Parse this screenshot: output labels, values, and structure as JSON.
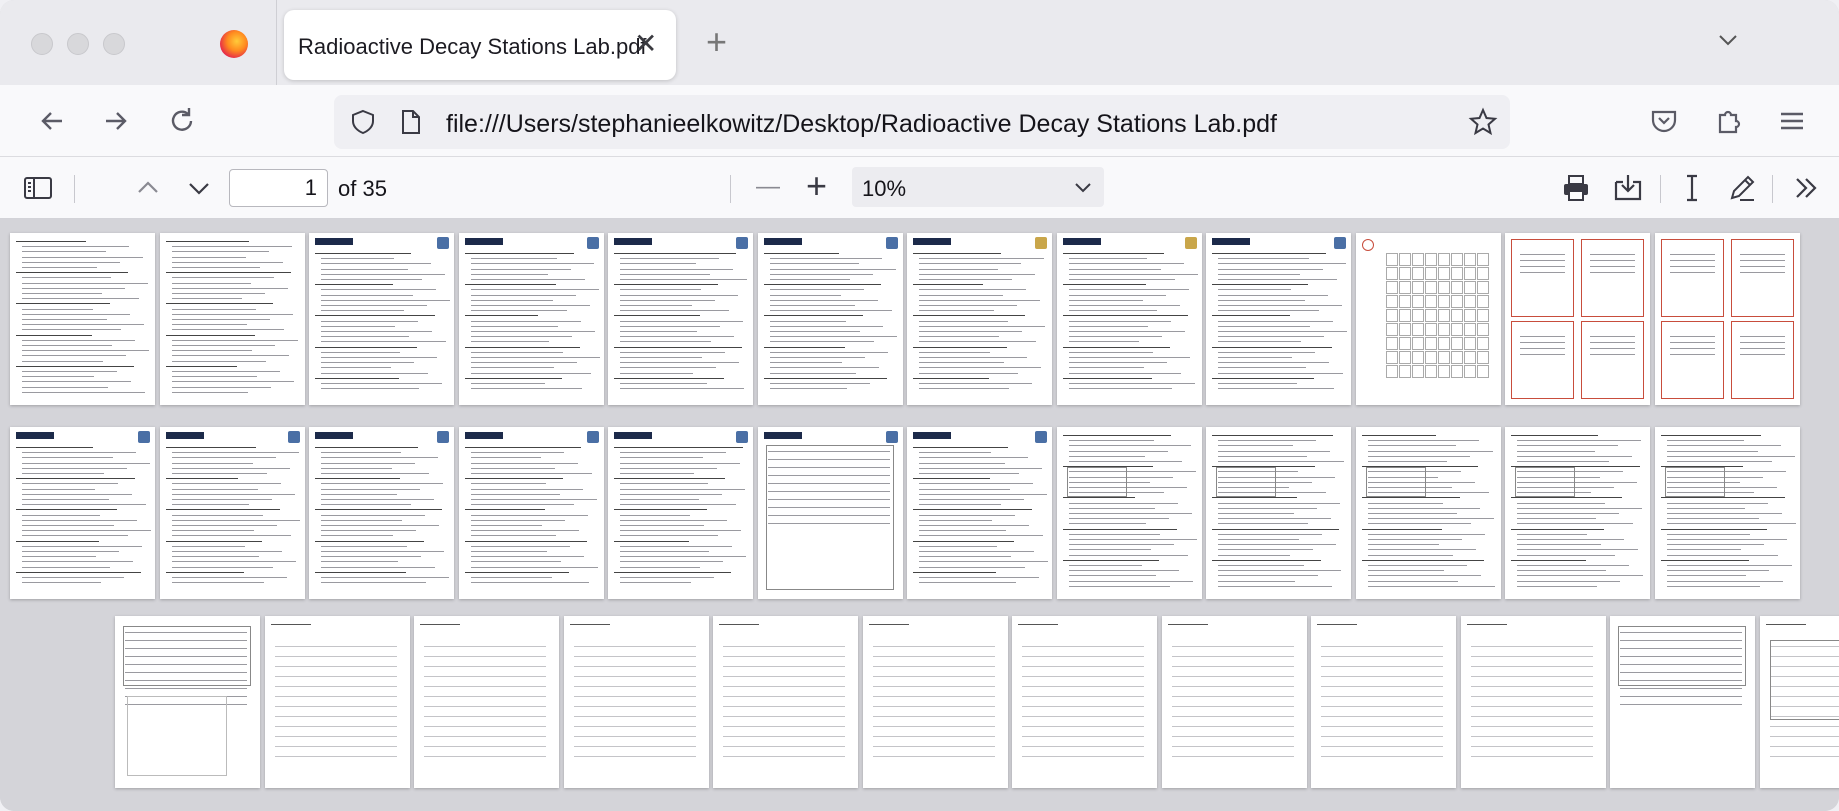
{
  "tab": {
    "title": "Radioactive Decay Stations Lab.pdf",
    "close_symbol": "✕",
    "new_tab_symbol": "+"
  },
  "navbar": {
    "url": "file:///Users/stephanieelkowitz/Desktop/Radioactive Decay Stations Lab.pdf"
  },
  "pdf_toolbar": {
    "current_page": "1",
    "page_count_label": "of 35",
    "zoom": "10%",
    "zoom_out_symbol": "—",
    "zoom_in_symbol": "+"
  },
  "icons": [
    "sidebar-toggle-icon",
    "page-up-icon",
    "page-down-icon",
    "print-icon",
    "save-icon",
    "text-select-icon",
    "draw-icon",
    "more-tools-icon",
    "back-icon",
    "forward-icon",
    "reload-icon",
    "shield-icon",
    "page-icon",
    "bookmark-star-icon",
    "pocket-icon",
    "extensions-icon",
    "menu-icon"
  ],
  "colors": {
    "accent_red": "#c84d3c",
    "header_navy": "#1c2a4a",
    "viewer_bg": "#d4d4d9"
  },
  "thumbnails": {
    "row1": [
      "cover",
      "cover2",
      "skills",
      "skills",
      "skills",
      "skills",
      "narrative",
      "narrative",
      "assessment",
      "periodic",
      "question-cards",
      "question-cards2"
    ],
    "row2": [
      "problem",
      "problem",
      "problem",
      "problem",
      "synthesis",
      "synthesis-table",
      "synthesis",
      "recording",
      "recording",
      "recording",
      "recording",
      "recording"
    ],
    "row3": [
      "recording-chart",
      "lined",
      "lined",
      "lined",
      "lined",
      "lined",
      "lined",
      "lined",
      "lined",
      "lined",
      "recording-table",
      "recording-form"
    ]
  }
}
